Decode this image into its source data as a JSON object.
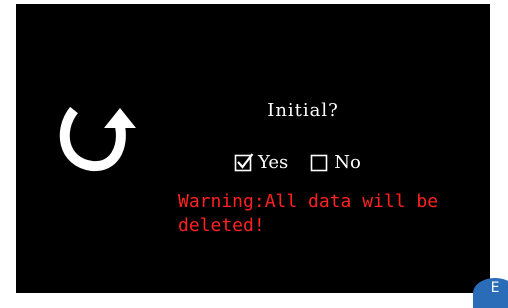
{
  "dialog": {
    "title": "Initial?",
    "options": [
      {
        "label": "Yes",
        "checked": true
      },
      {
        "label": "No",
        "checked": false
      }
    ],
    "warning": "Warning:All data will be\ndeleted!"
  },
  "badge": {
    "text": "E"
  },
  "icons": {
    "main": "undo-arrow-icon"
  },
  "colors": {
    "background": "#000000",
    "text": "#ffffff",
    "warning": "#ff2020",
    "badge": "#2b6cb8"
  }
}
